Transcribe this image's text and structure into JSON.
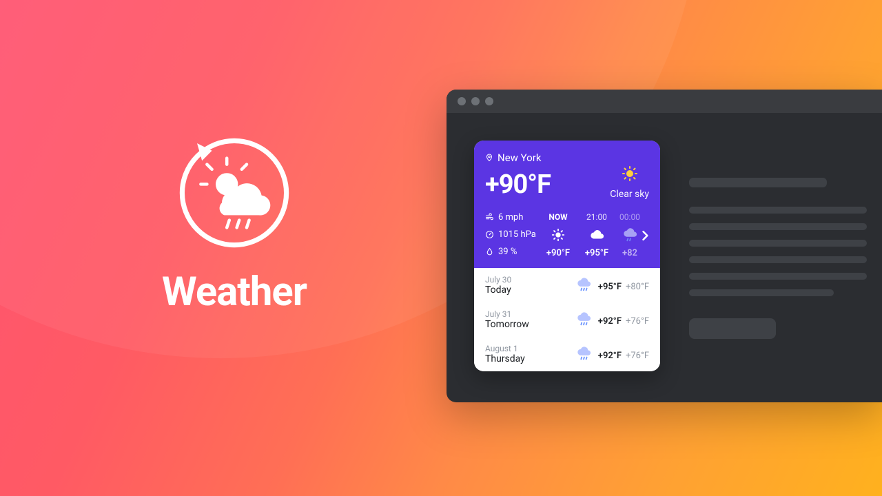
{
  "hero": {
    "title": "Weather"
  },
  "window": {
    "traffic_lights": 3
  },
  "card": {
    "location": "New York",
    "current_temp": "+90°F",
    "condition": "Clear sky",
    "stats": {
      "wind": "6 mph",
      "pressure": "1015 hPa",
      "humidity": "39 %"
    },
    "hourly": [
      {
        "time": "NOW",
        "icon": "sun",
        "temp": "+90°F"
      },
      {
        "time": "21:00",
        "icon": "cloud",
        "temp": "+95°F"
      },
      {
        "time": "00:00",
        "icon": "cloud-rain",
        "temp": "+82"
      }
    ],
    "daily": [
      {
        "date": "July 30",
        "label": "Today",
        "icon": "cloud-rain",
        "hi": "+95°F",
        "lo": "+80°F"
      },
      {
        "date": "July 31",
        "label": "Tomorrow",
        "icon": "cloud-rain",
        "hi": "+92°F",
        "lo": "+76°F"
      },
      {
        "date": "August 1",
        "label": "Thursday",
        "icon": "cloud-rain",
        "hi": "+92°F",
        "lo": "+76°F"
      }
    ]
  },
  "icons": {
    "sun_color": "#ffcf3f",
    "cloud_color": "#c8cffc",
    "rain_color": "#7aa7ff"
  }
}
